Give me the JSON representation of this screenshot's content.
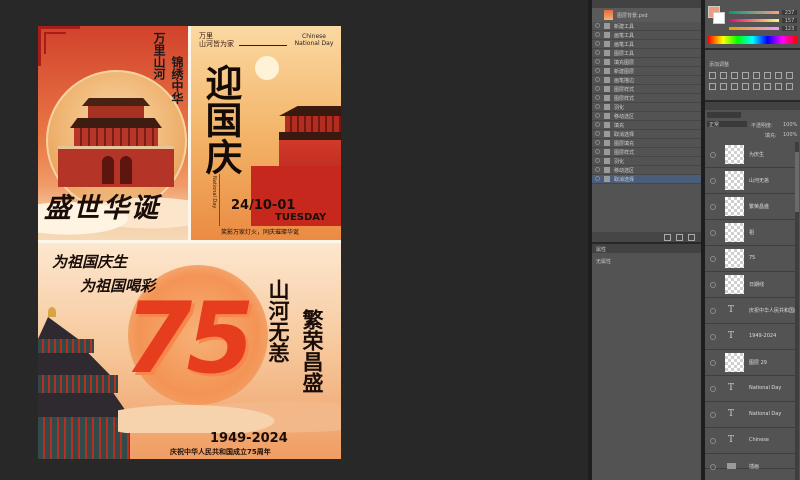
{
  "poster": {
    "top_left": {
      "vertical_1": "万里山河",
      "vertical_2": "锦绣中华",
      "bottom_calligraphy": "盛世华诞"
    },
    "top_right": {
      "small_left": "万里\n山河皆为家",
      "english": "Chinese\nNational Day",
      "main_calligraphy": "迎国庆",
      "vertical_english": "National Day",
      "date": "24/10-01",
      "weekday": "TUESDAY",
      "slogan": "笑影万家灯火，同庆璀璨华诞"
    },
    "bottom": {
      "line1": "为祖国庆生",
      "line2": "为祖国喝彩",
      "vertical_1": "山河无恙",
      "vertical_2": "繁荣昌盛",
      "big_number": "75",
      "years": "1949-2024",
      "caption": "庆祝中华人民共和国成立75周年"
    }
  },
  "history_panel": {
    "title": "图层背景.psd",
    "items": [
      "新建工具",
      "画笔工具",
      "画笔工具",
      "图层工具",
      "填充图层",
      "新建图层",
      "画笔描边",
      "图层样式",
      "图层样式",
      "羽化",
      "移动选区",
      "填充",
      "取消选择",
      "图层填充",
      "图层样式",
      "羽化",
      "移动选区",
      "取消选择"
    ]
  },
  "color_panel": {
    "values": [
      "237",
      "157",
      "123"
    ]
  },
  "adjust_panel": {
    "title": "添加调整"
  },
  "layers_panel": {
    "blend_mode": "正常",
    "opacity_label": "不透明度:",
    "opacity": "100%",
    "fill_label": "填充:",
    "fill": "100%",
    "layers": [
      {
        "name": "为庆生",
        "type": "pixel"
      },
      {
        "name": "山河无恙",
        "type": "pixel"
      },
      {
        "name": "繁荣昌盛",
        "type": "pixel"
      },
      {
        "name": "祖",
        "type": "pixel"
      },
      {
        "name": "75",
        "type": "pixel"
      },
      {
        "name": "日期线",
        "type": "pixel"
      },
      {
        "name": "庆祝中华人民共和国成...",
        "type": "text"
      },
      {
        "name": "1949-2024",
        "type": "text"
      },
      {
        "name": "图层 29",
        "type": "pixel"
      },
      {
        "name": "National Day",
        "type": "text"
      },
      {
        "name": "National Day",
        "type": "text"
      },
      {
        "name": "Chinese",
        "type": "text"
      },
      {
        "name": "插画",
        "type": "group"
      },
      {
        "name": "背景",
        "type": "group"
      }
    ]
  },
  "properties_panel": {
    "title": "属性",
    "label": "无属性"
  },
  "colors": {
    "bg": "#282828",
    "panel": "#535353",
    "red": "#c7281e",
    "orange": "#f08a3c",
    "gold": "#f2c47e"
  }
}
